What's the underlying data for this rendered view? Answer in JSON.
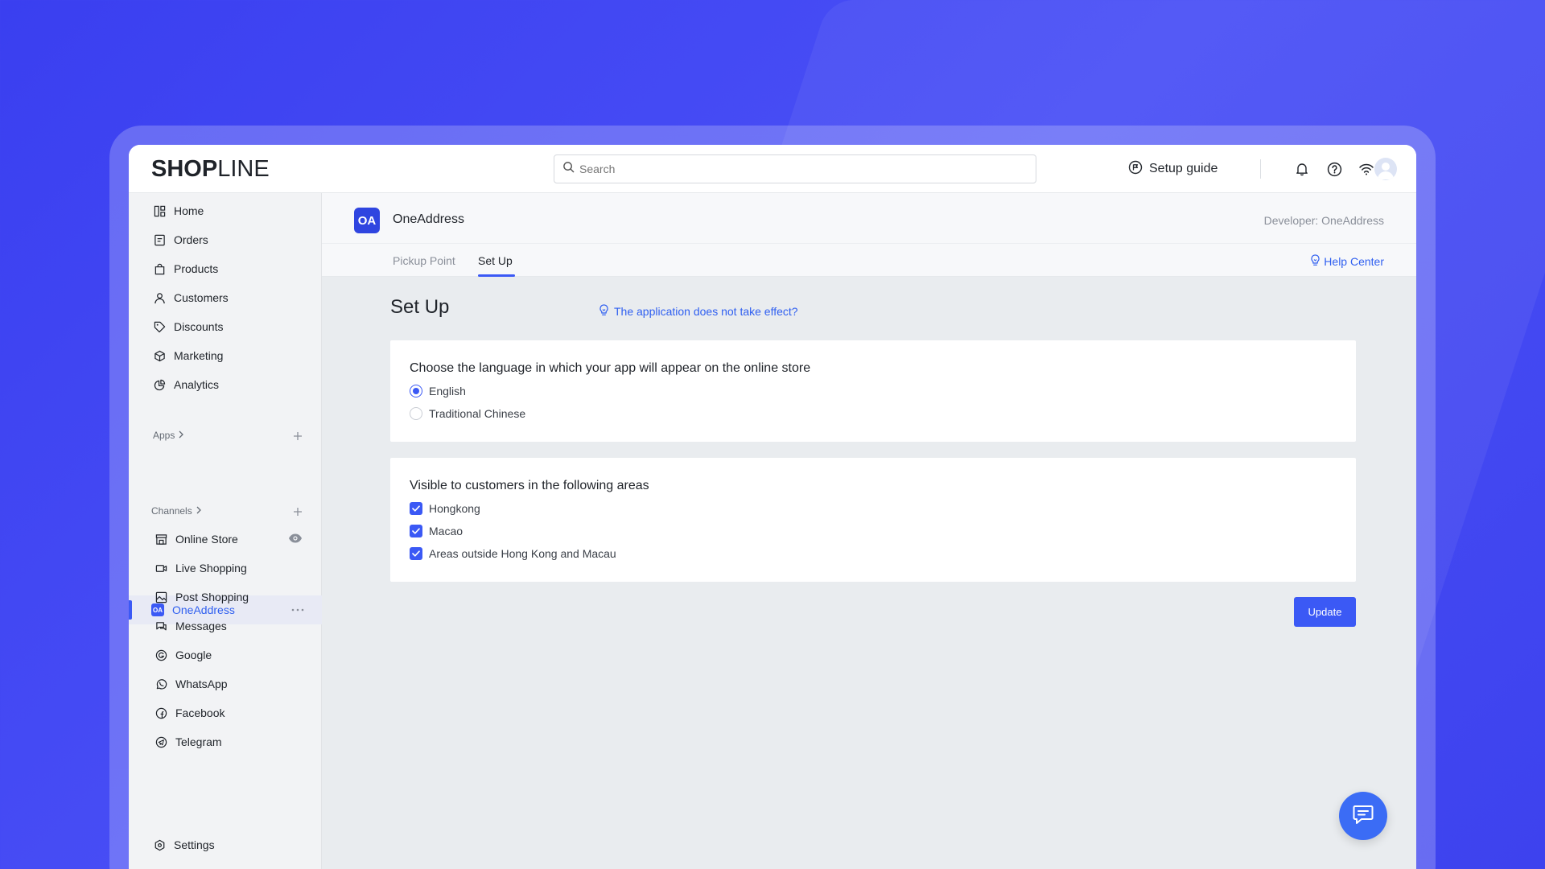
{
  "header": {
    "logo_bold": "SHOP",
    "logo_light": "LINE",
    "search_placeholder": "Search",
    "setup_guide": "Setup guide"
  },
  "sidebar": {
    "main_items": [
      {
        "label": "Home",
        "icon": "home-icon"
      },
      {
        "label": "Orders",
        "icon": "orders-icon"
      },
      {
        "label": "Products",
        "icon": "bag-icon"
      },
      {
        "label": "Customers",
        "icon": "person-icon"
      },
      {
        "label": "Discounts",
        "icon": "tag-icon"
      },
      {
        "label": "Marketing",
        "icon": "cube-icon"
      },
      {
        "label": "Analytics",
        "icon": "pie-icon"
      }
    ],
    "apps_label": "Apps",
    "active_app": {
      "label": "OneAddress",
      "badge": "OA"
    },
    "channels_label": "Channels",
    "channels": [
      {
        "label": "Online Store",
        "icon": "store-icon"
      },
      {
        "label": "Live Shopping",
        "icon": "video-icon"
      },
      {
        "label": "Post Shopping",
        "icon": "post-icon"
      },
      {
        "label": "Messages",
        "icon": "messages-icon"
      },
      {
        "label": "Google",
        "icon": "google-icon"
      },
      {
        "label": "WhatsApp",
        "icon": "whatsapp-icon"
      },
      {
        "label": "Facebook",
        "icon": "facebook-icon"
      },
      {
        "label": "Telegram",
        "icon": "telegram-icon"
      }
    ],
    "settings_label": "Settings"
  },
  "app": {
    "logo": "OA",
    "name": "OneAddress",
    "developer": "Developer: OneAddress",
    "tabs": [
      {
        "label": "Pickup Point",
        "active": false
      },
      {
        "label": "Set Up",
        "active": true
      }
    ],
    "help_center": "Help Center"
  },
  "page": {
    "title": "Set Up",
    "effect_link": "The application does not take effect?",
    "language_card": {
      "title": "Choose the language in which your app will appear on the online store",
      "options": [
        {
          "label": "English",
          "selected": true
        },
        {
          "label": "Traditional Chinese",
          "selected": false
        }
      ]
    },
    "areas_card": {
      "title": "Visible to customers in the following areas",
      "options": [
        {
          "label": "Hongkong",
          "checked": true
        },
        {
          "label": "Macao",
          "checked": true
        },
        {
          "label": "Areas outside Hong Kong and Macau",
          "checked": true
        }
      ]
    },
    "update_button": "Update"
  },
  "colors": {
    "accent": "#3b59f5",
    "link": "#2f5ff0",
    "background": "#3a3ff0"
  }
}
